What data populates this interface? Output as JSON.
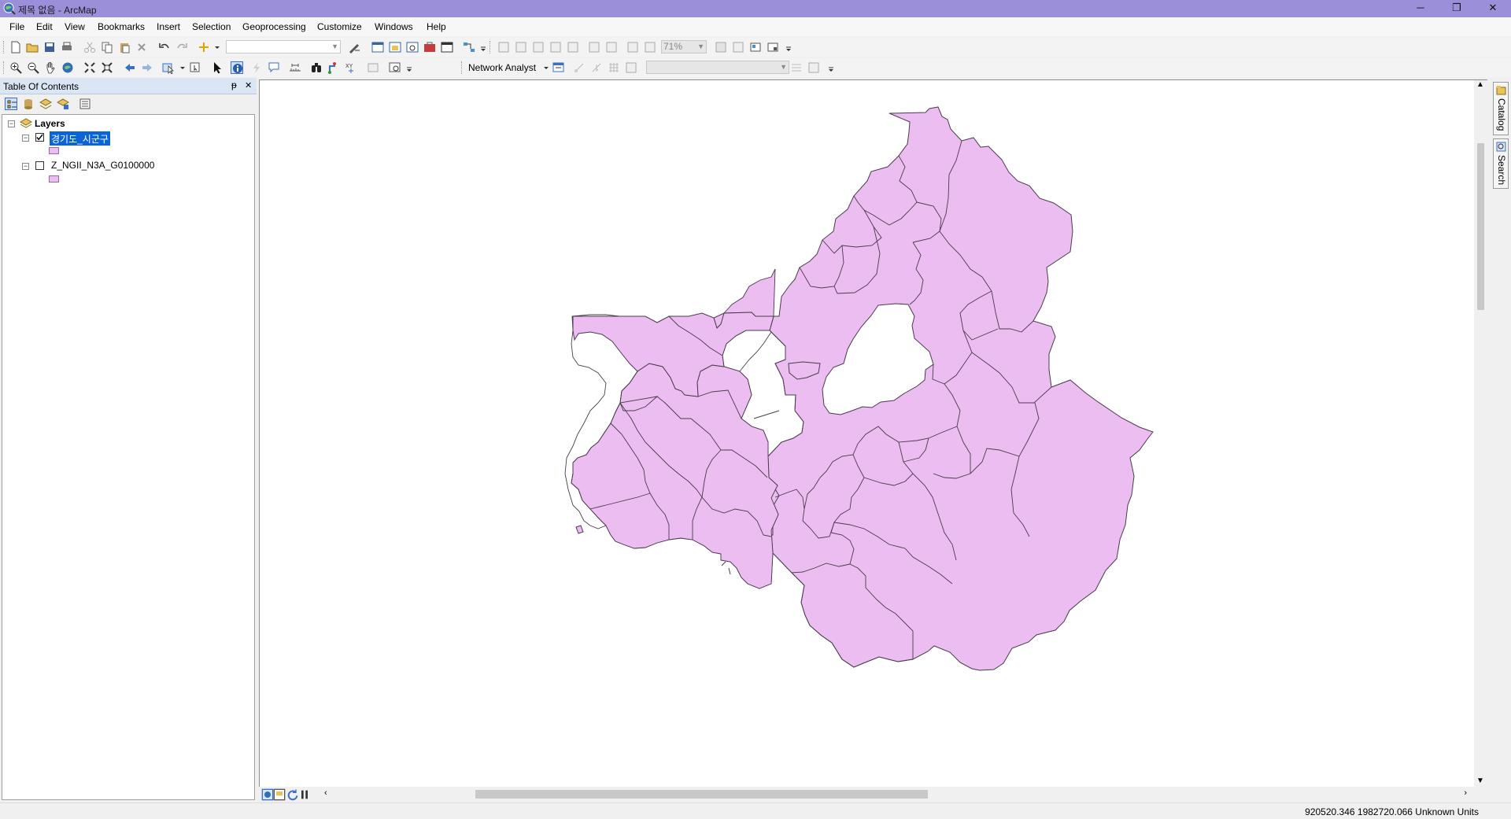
{
  "window": {
    "title": "제목 없음 - ArcMap",
    "controls": [
      "─",
      "❐",
      "✕"
    ]
  },
  "menu": [
    "File",
    "Edit",
    "View",
    "Bookmarks",
    "Insert",
    "Selection",
    "Geoprocessing",
    "Customize",
    "Windows",
    "Help"
  ],
  "toolbar": {
    "scale_value": "",
    "zoom_percent": "71%",
    "network_analyst_label": "Network Analyst"
  },
  "toc": {
    "title": "Table Of Contents",
    "pin": "ᵽ",
    "close": "✕",
    "root_label": "Layers",
    "layers": [
      {
        "name": "경기도_시군구",
        "checked": true,
        "selected": true,
        "symbol_color": "#ecbdf0"
      },
      {
        "name": "Z_NGII_N3A_G0100000",
        "checked": false,
        "selected": false,
        "symbol_color": "#ecbdf0"
      }
    ]
  },
  "side_tabs": [
    "Catalog",
    "Search"
  ],
  "map": {
    "fill_color": "#ecbdf0",
    "stroke_color": "#4b3a4e"
  },
  "status": {
    "coordinates": "920520.346  1982720.066 Unknown Units"
  },
  "colors": {
    "titlebar": "#9b8fd9",
    "selection_highlight": "#0a64d8",
    "toc_header": "#dbe6f4"
  }
}
